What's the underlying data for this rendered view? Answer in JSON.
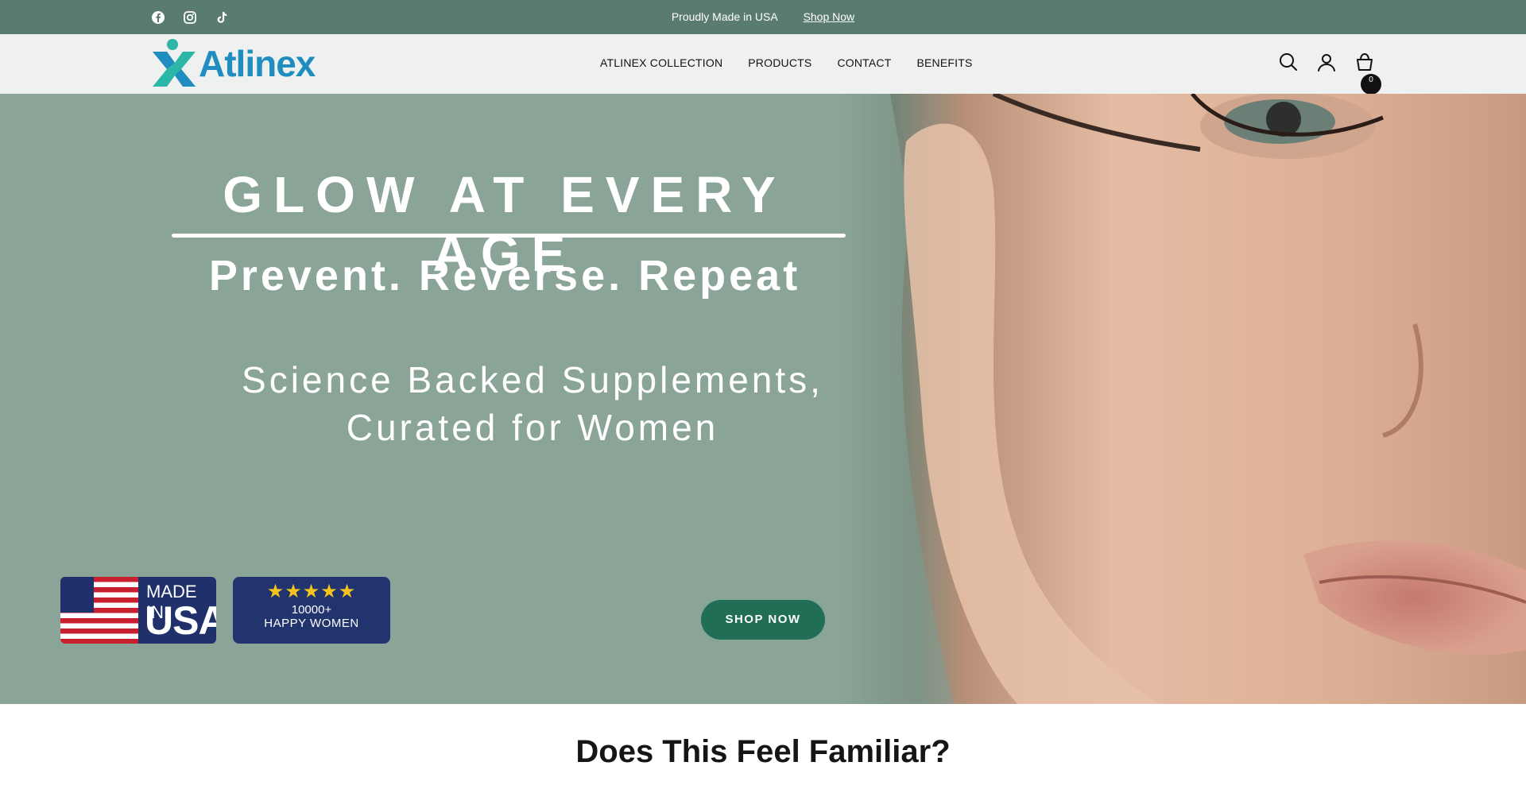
{
  "announcement": {
    "message": "Proudly Made in USA",
    "link": "Shop Now",
    "social_icons": [
      "facebook-icon",
      "instagram-icon",
      "tiktok-icon"
    ]
  },
  "header": {
    "logo_text": "Atlinex",
    "nav": [
      "ATLINEX COLLECTION",
      "PRODUCTS",
      "CONTACT",
      "BENEFITS"
    ],
    "icons": [
      "search-icon",
      "account-icon",
      "cart-icon"
    ],
    "cart_count": "0"
  },
  "hero": {
    "title": "GLOW AT EVERY AGE",
    "subtitle": "Prevent. Reverse. Repeat",
    "description_line1": "Science Backed Supplements,",
    "description_line2": "Curated for Women",
    "badge_made": "MADE IN",
    "badge_usa": "USA",
    "rating_stars": "★★★★★",
    "rating_count": "10000+",
    "rating_label": "HAPPY WOMEN",
    "button": "SHOP NOW"
  },
  "section": {
    "title": "Does This Feel Familiar?"
  },
  "colors": {
    "announcement_bg": "#5a7b71",
    "header_bg": "#eef1ef",
    "logo_blue": "#1f8dbf",
    "logo_teal": "#2bb6a6",
    "button_green": "#1f6e55",
    "badge_navy": "#22346e"
  }
}
